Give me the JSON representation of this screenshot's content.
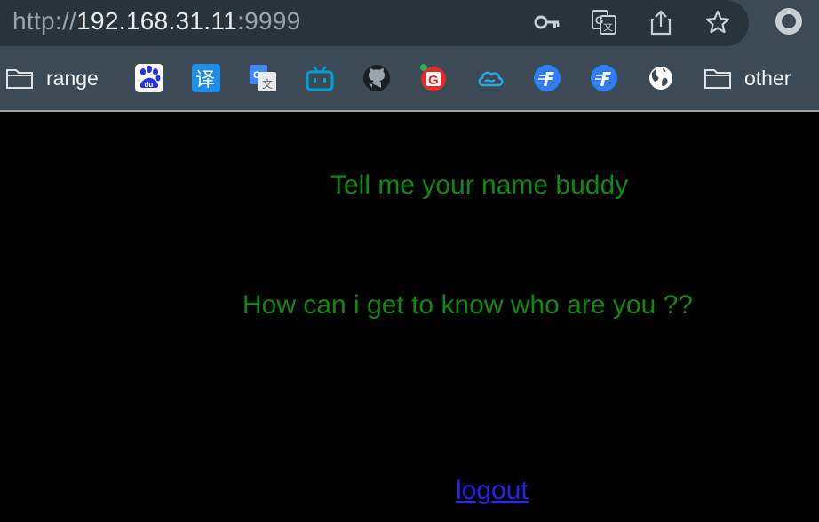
{
  "browser": {
    "url_scheme": "http://",
    "url_host": "192.168.31.11",
    "url_port": ":9999",
    "toolbar_icons": [
      "key-icon",
      "translate-icon",
      "share-icon",
      "star-icon"
    ],
    "profile_icon": "profile-icon"
  },
  "bookmarks": {
    "items": [
      {
        "label": "range",
        "icon": "folder-icon"
      },
      {
        "label": "",
        "icon": "baidu-icon"
      },
      {
        "label": "",
        "icon": "translate-yi-icon"
      },
      {
        "label": "",
        "icon": "google-translate-icon"
      },
      {
        "label": "",
        "icon": "bilibili-icon"
      },
      {
        "label": "",
        "icon": "github-icon"
      },
      {
        "label": "",
        "icon": "g-red-icon"
      },
      {
        "label": "",
        "icon": "cloud-icon"
      },
      {
        "label": "",
        "icon": "f-blue-icon"
      },
      {
        "label": "",
        "icon": "f-blue-icon"
      },
      {
        "label": "",
        "icon": "globe-icon"
      },
      {
        "label": "other",
        "icon": "folder-icon"
      }
    ]
  },
  "page": {
    "line1": "Tell me your name buddy",
    "line2": "How can i get to know who are you ??",
    "logout_label": "logout"
  },
  "colors": {
    "text_green": "#0f8a0f",
    "link_blue": "#2424ee",
    "background": "#000000"
  }
}
